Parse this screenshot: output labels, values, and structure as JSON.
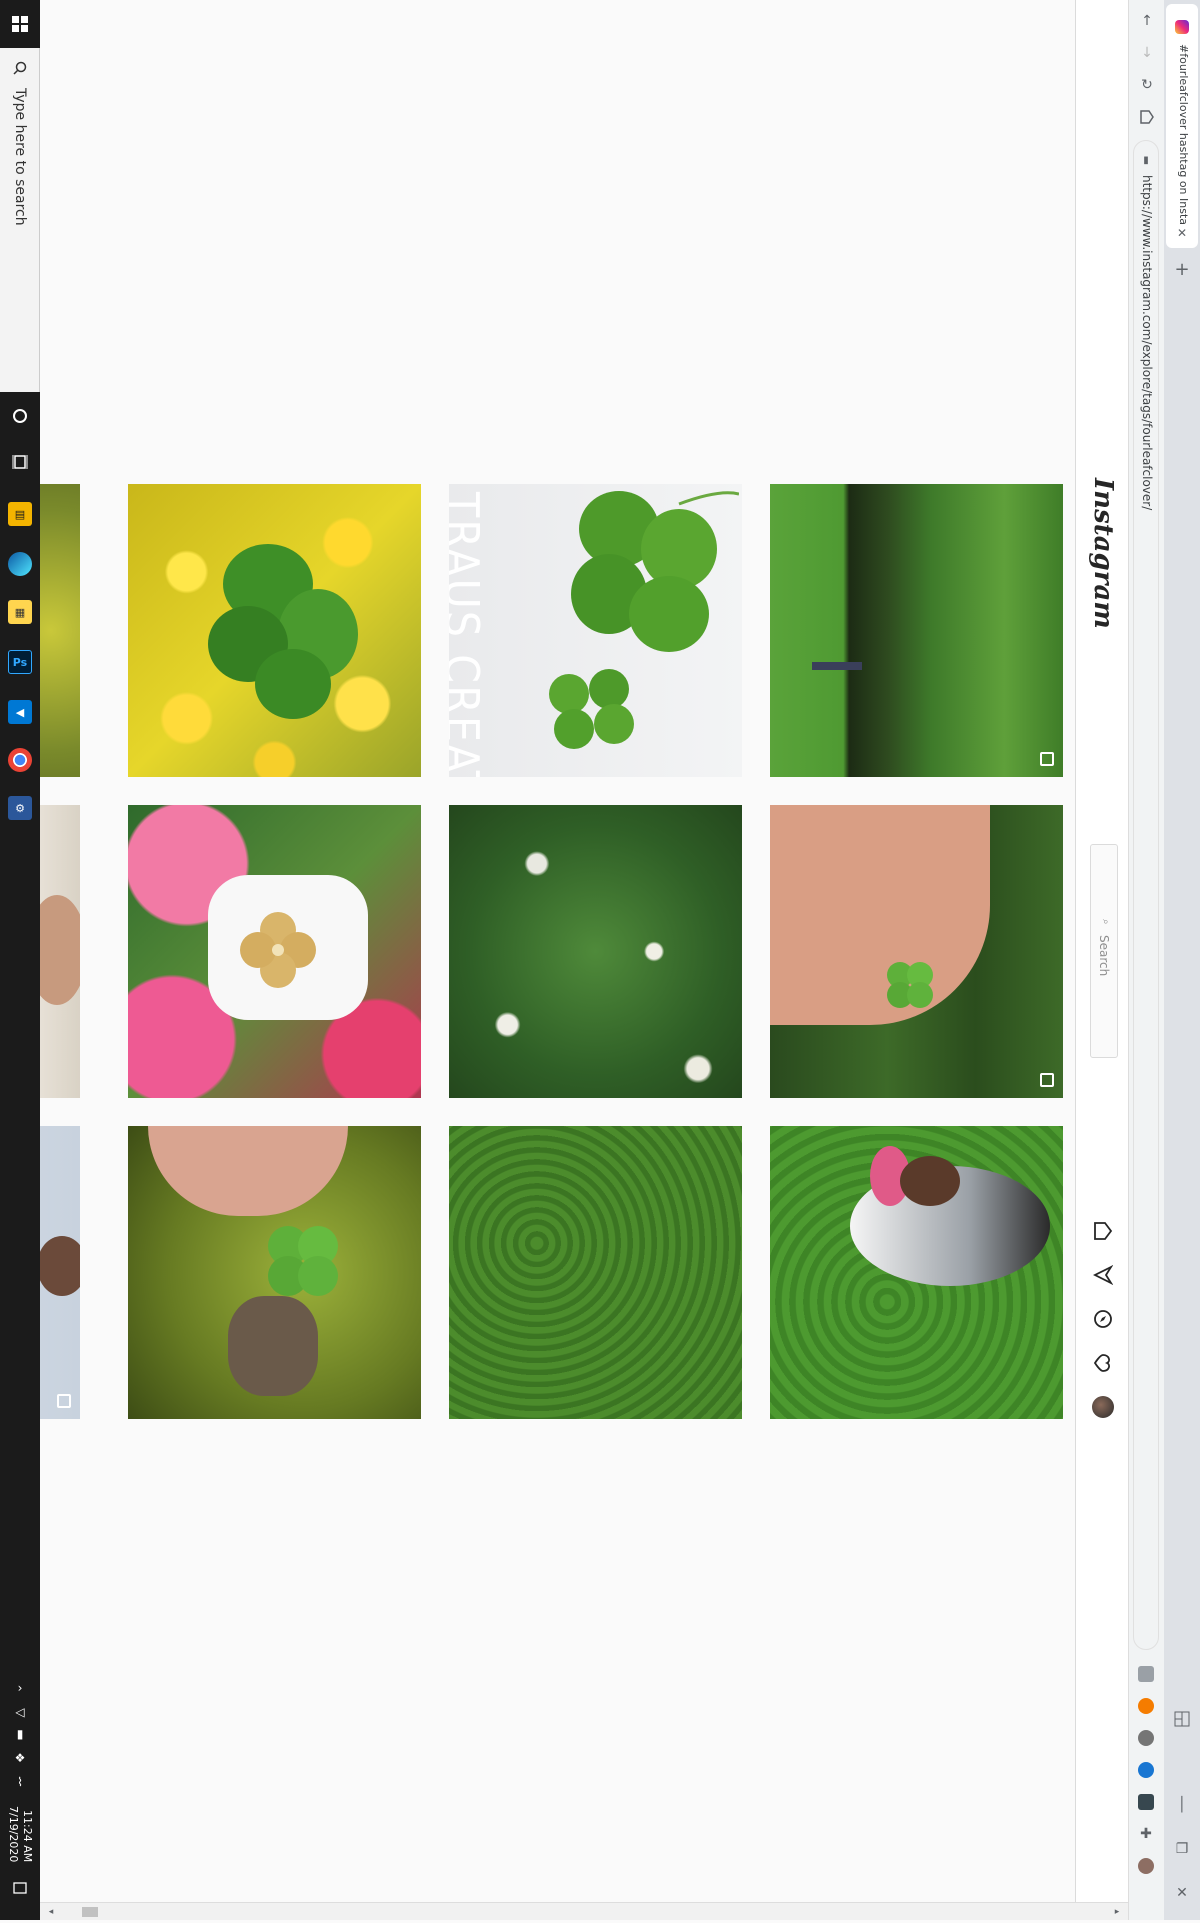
{
  "taskbar": {
    "search_placeholder": "Type here to search",
    "clock_time": "11:24 AM",
    "clock_date": "7/19/2020",
    "apps": [
      "file-explorer",
      "edge",
      "notes",
      "photoshop",
      "vscode",
      "chrome",
      "settings"
    ]
  },
  "browser": {
    "tab_title": "#fourleafclover hashtag on Insta",
    "url": "https://www.instagram.com/explore/tags/fourleafclover/",
    "new_tab_label": "+",
    "close_tab_label": "✕"
  },
  "instagram": {
    "logo": "Instagram",
    "search_placeholder": "Search"
  },
  "colors": {
    "taskbar_bg": "#1b1b1b",
    "page_bg": "#fafafa",
    "ig_border": "#dbdbdb"
  }
}
